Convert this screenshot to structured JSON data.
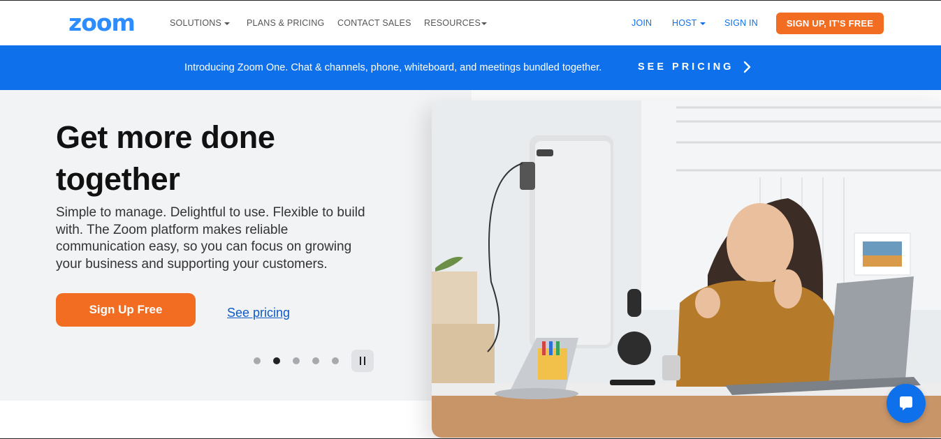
{
  "nav": {
    "logo": "zoom",
    "solutions": "SOLUTIONS",
    "plans": "PLANS & PRICING",
    "contact": "CONTACT SALES",
    "resources": "RESOURCES",
    "join": "JOIN",
    "host": "HOST",
    "signin": "SIGN IN",
    "signup": "SIGN UP, IT'S FREE"
  },
  "banner": {
    "text": "Introducing Zoom One. Chat & channels, phone, whiteboard, and meetings bundled together.",
    "cta": "SEE PRICING"
  },
  "hero": {
    "title": "Get more done together",
    "body": "Simple to manage. Delightful to use. Flexible to build with. The Zoom platform makes reliable communication easy, so you can focus on growing your business and supporting your customers.",
    "primary": "Sign Up Free",
    "secondary": "See pricing",
    "carousel": {
      "slide_count": 5,
      "active_slide": 2
    }
  },
  "colors": {
    "brand_blue": "#2D8CFF",
    "link_blue": "#0E71EB",
    "cta_orange": "#F26D21",
    "hero_bg": "#F2F3F5"
  },
  "icons": [
    "chevron-right-icon",
    "caret-down-icon",
    "pause-icon",
    "chat-bubble-icon"
  ]
}
